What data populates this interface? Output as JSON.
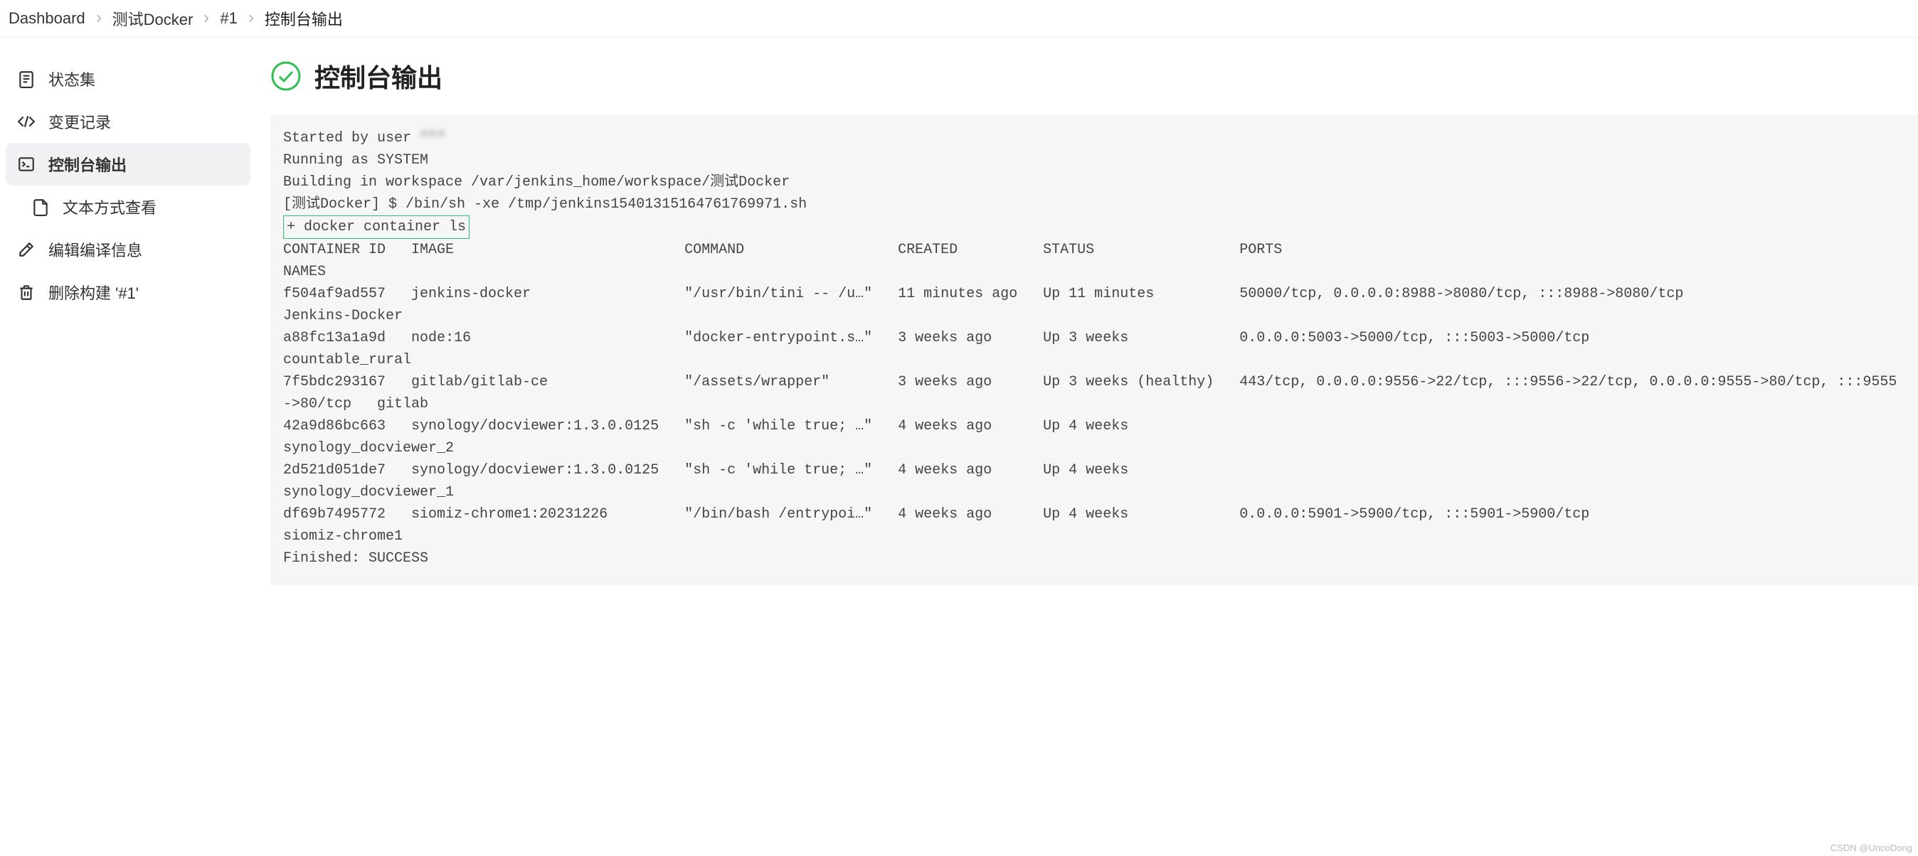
{
  "breadcrumb": [
    {
      "label": "Dashboard"
    },
    {
      "label": "测试Docker"
    },
    {
      "label": "#1"
    },
    {
      "label": "控制台输出"
    }
  ],
  "sidebar": [
    {
      "label": "状态集",
      "name": "sidebar-item-status",
      "icon": "document-icon",
      "sub": false,
      "active": false
    },
    {
      "label": "变更记录",
      "name": "sidebar-item-changes",
      "icon": "code-icon",
      "sub": false,
      "active": false
    },
    {
      "label": "控制台输出",
      "name": "sidebar-item-console",
      "icon": "terminal-icon",
      "sub": false,
      "active": true
    },
    {
      "label": "文本方式查看",
      "name": "sidebar-item-plaintext",
      "icon": "file-icon",
      "sub": true,
      "active": false
    },
    {
      "label": "编辑编译信息",
      "name": "sidebar-item-edit-info",
      "icon": "edit-icon",
      "sub": false,
      "active": false
    },
    {
      "label": "删除构建 '#1'",
      "name": "sidebar-item-delete",
      "icon": "trash-icon",
      "sub": false,
      "active": false
    }
  ],
  "page": {
    "title": "控制台输出"
  },
  "console": {
    "started_prefix": "Started by user ",
    "started_user": "***",
    "line2": "Running as SYSTEM",
    "line3": "Building in workspace /var/jenkins_home/workspace/测试Docker",
    "line4": "[测试Docker] $ /bin/sh -xe /tmp/jenkins15401315164761769971.sh",
    "highlight_cmd": "+ docker container ls",
    "header": "CONTAINER ID   IMAGE                           COMMAND                  CREATED          STATUS                 PORTS                                                                                      NAMES",
    "row1": "f504af9ad557   jenkins-docker                  \"/usr/bin/tini -- /u…\"   11 minutes ago   Up 11 minutes          50000/tcp, 0.0.0.0:8988->8080/tcp, :::8988->8080/tcp                                       Jenkins-Docker",
    "row2": "a88fc13a1a9d   node:16                         \"docker-entrypoint.s…\"   3 weeks ago      Up 3 weeks             0.0.0.0:5003->5000/tcp, :::5003->5000/tcp                                                  countable_rural",
    "row3": "7f5bdc293167   gitlab/gitlab-ce                \"/assets/wrapper\"        3 weeks ago      Up 3 weeks (healthy)   443/tcp, 0.0.0.0:9556->22/tcp, :::9556->22/tcp, 0.0.0.0:9555->80/tcp, :::9555->80/tcp   gitlab",
    "row4": "42a9d86bc663   synology/docviewer:1.3.0.0125   \"sh -c 'while true; …\"   4 weeks ago      Up 4 weeks                                                                                                        synology_docviewer_2",
    "row5": "2d521d051de7   synology/docviewer:1.3.0.0125   \"sh -c 'while true; …\"   4 weeks ago      Up 4 weeks                                                                                                        synology_docviewer_1",
    "row6": "df69b7495772   siomiz-chrome1:20231226         \"/bin/bash /entrypoi…\"   4 weeks ago      Up 4 weeks             0.0.0.0:5901->5900/tcp, :::5901->5900/tcp                                                  siomiz-chrome1",
    "finished": "Finished: SUCCESS"
  },
  "watermark": "CSDN @UncoDong"
}
